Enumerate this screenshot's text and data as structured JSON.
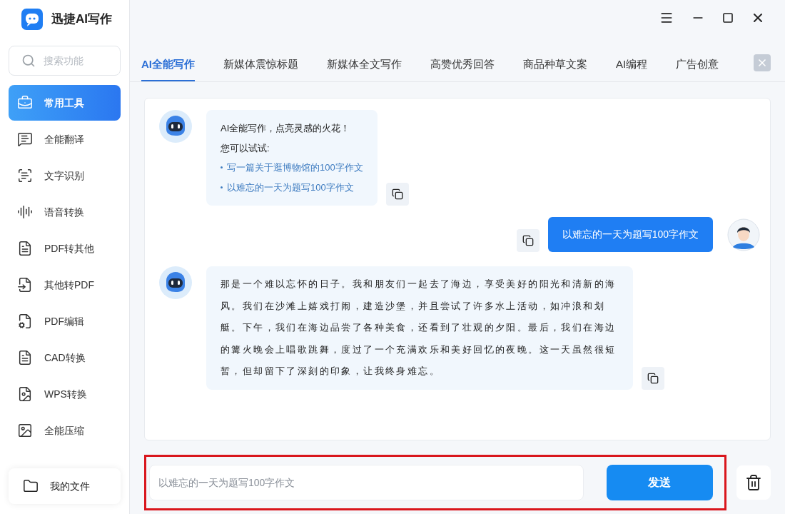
{
  "app": {
    "title": "迅捷AI写作"
  },
  "sidebar": {
    "search": {
      "placeholder": "搜索功能"
    },
    "items": [
      {
        "label": "常用工具",
        "selected": true
      },
      {
        "label": "全能翻译",
        "selected": false
      },
      {
        "label": "文字识别",
        "selected": false
      },
      {
        "label": "语音转换",
        "selected": false
      },
      {
        "label": "PDF转其他",
        "selected": false
      },
      {
        "label": "其他转PDF",
        "selected": false
      },
      {
        "label": "PDF编辑",
        "selected": false
      },
      {
        "label": "CAD转换",
        "selected": false
      },
      {
        "label": "WPS转换",
        "selected": false
      },
      {
        "label": "全能压缩",
        "selected": false
      }
    ],
    "files": {
      "label": "我的文件"
    }
  },
  "tabs": [
    {
      "label": "AI全能写作",
      "selected": true
    },
    {
      "label": "新媒体震惊标题",
      "selected": false
    },
    {
      "label": "新媒体全文写作",
      "selected": false
    },
    {
      "label": "高赞优秀回答",
      "selected": false
    },
    {
      "label": "商品种草文案",
      "selected": false
    },
    {
      "label": "AI编程",
      "selected": false
    },
    {
      "label": "广告创意",
      "selected": false
    }
  ],
  "messages": [
    {
      "kind": "welcome",
      "title": "AI全能写作，点亮灵感的火花！",
      "hint": "您可以试试:",
      "suggestions": [
        "写一篇关于逛博物馆的100字作文",
        "以难忘的一天为题写100字作文"
      ]
    },
    {
      "kind": "user",
      "text": "以难忘的一天为题写100字作文"
    },
    {
      "kind": "bot",
      "text": "那是一个难以忘怀的日子。我和朋友们一起去了海边，享受美好的阳光和清新的海风。我们在沙滩上嬉戏打闹，建造沙堡，并且尝试了许多水上活动，如冲浪和划艇。下午，我们在海边品尝了各种美食，还看到了壮观的夕阳。最后，我们在海边的篝火晚会上唱歌跳舞，度过了一个充满欢乐和美好回忆的夜晚。这一天虽然很短暂，但却留下了深刻的印象，让我终身难忘。"
    }
  ],
  "composer": {
    "placeholder": "以难忘的一天为题写100字作文",
    "send": "发送",
    "highlighted": true
  }
}
